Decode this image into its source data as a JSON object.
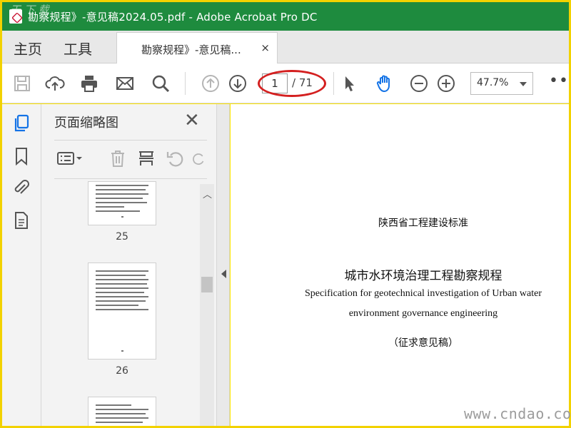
{
  "window": {
    "title": "勘察规程》-意见稿2024.05.pdf - Adobe Acrobat Pro DC",
    "corner_watermark": "天 下 载"
  },
  "tabs": {
    "home": "主页",
    "tools": "工具",
    "document": "勘察规程》-意见稿...",
    "close": "×"
  },
  "toolbar": {
    "icons": [
      "save-icon",
      "cloud-upload-icon",
      "print-icon",
      "email-icon",
      "search-icon",
      "page-up-icon",
      "page-down-icon",
      "select-arrow-icon",
      "hand-icon",
      "zoom-out-icon",
      "zoom-in-icon"
    ],
    "page_current": "1",
    "page_total": "/ 71",
    "zoom": "47.7%",
    "more": "•••",
    "highlight_color": "#d42020"
  },
  "rail": {
    "icons": [
      "pages-icon",
      "bookmark-icon",
      "attachment-icon",
      "document-properties-icon"
    ],
    "active_color": "#1473e6"
  },
  "thumbnails_panel": {
    "title": "页面缩略图",
    "close": "✕",
    "tools": [
      "thumbnail-options-icon",
      "delete-icon",
      "insert-page-icon",
      "rotate-left-icon",
      "rotate-right-icon"
    ],
    "pages": [
      {
        "label": "25"
      },
      {
        "label": "26"
      }
    ]
  },
  "document": {
    "standard_line": "陕西省工程建设标准",
    "title_cn": "城市水环境治理工程勘察规程",
    "title_en_line1": "Specification for geotechnical investigation of Urban water",
    "title_en_line2": "environment governance engineering",
    "draft_note": "（征求意见稿）"
  },
  "watermark": "www.cndao.com",
  "colors": {
    "titlebar": "#1e8b3e",
    "frame": "#f2d200"
  }
}
